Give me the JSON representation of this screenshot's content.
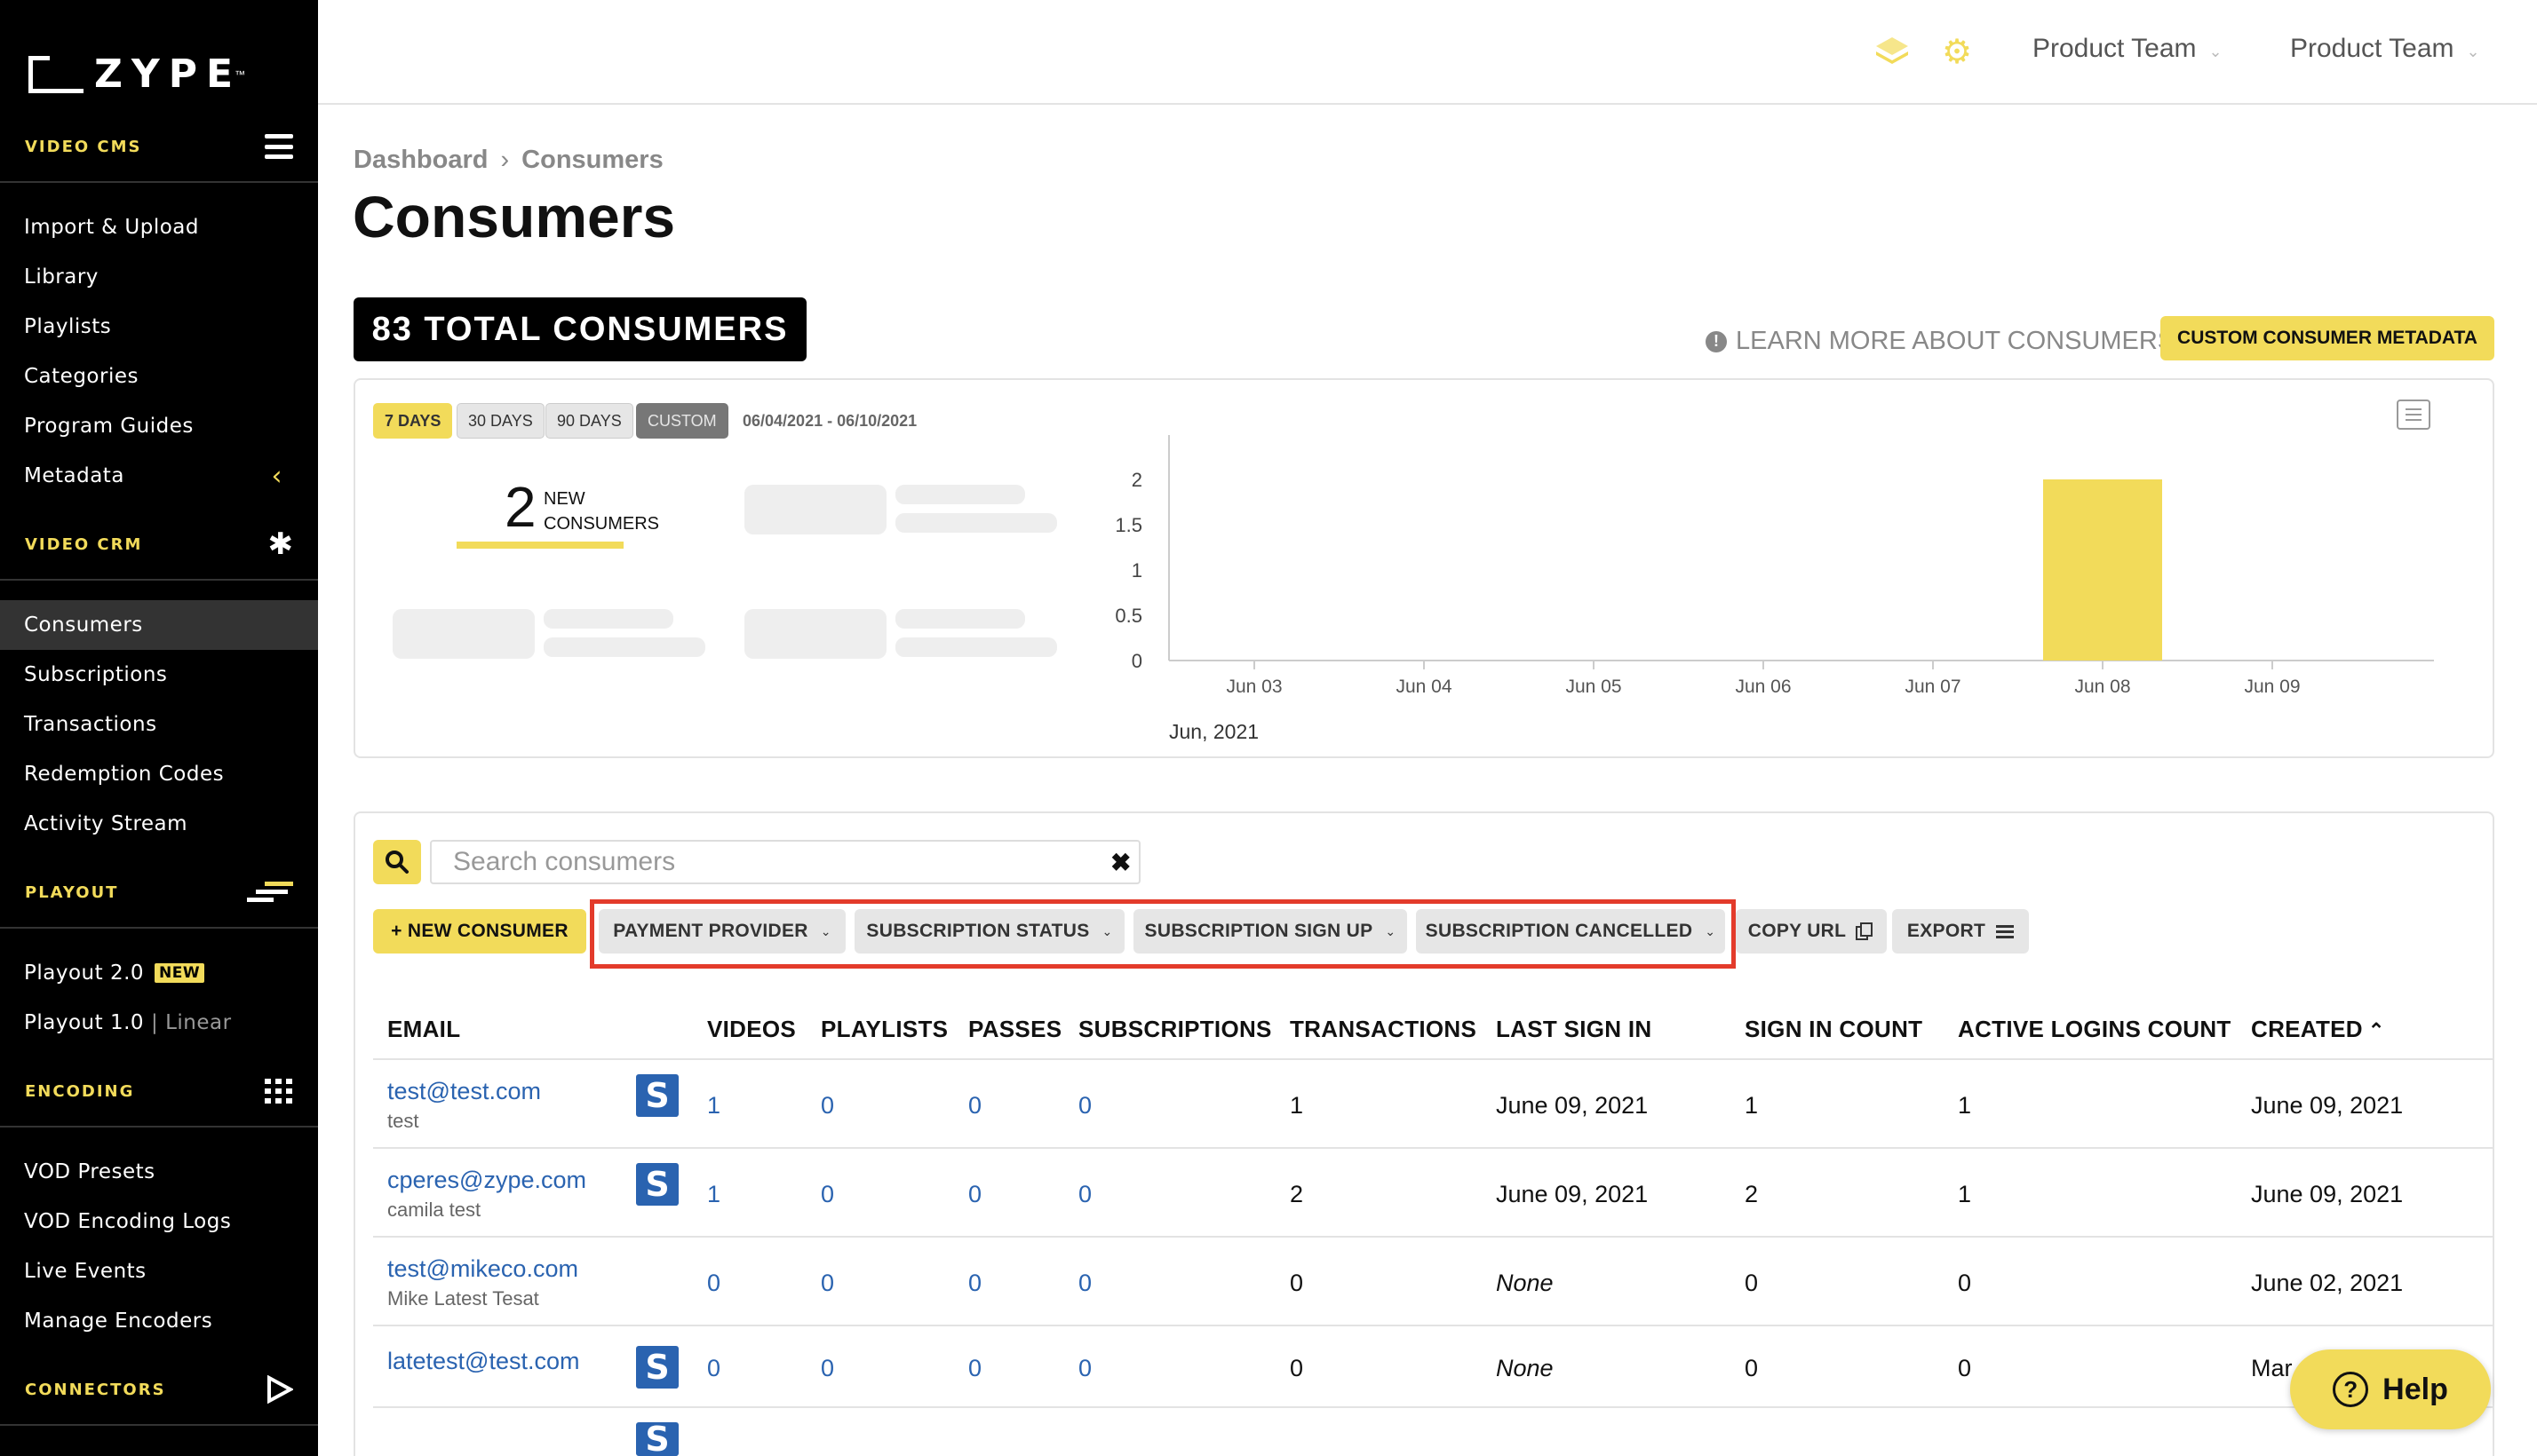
{
  "brand": {
    "name": "ZYPE",
    "tm": "™",
    "accent": "#f2db5a",
    "link": "#2a63b0",
    "highlight": "#e33b2b"
  },
  "sidebar": {
    "sections": [
      {
        "label": "VIDEO CMS",
        "icon": "hamburger-icon",
        "items": [
          "Import & Upload",
          "Library",
          "Playlists",
          "Categories",
          "Program Guides",
          "Metadata"
        ]
      },
      {
        "label": "VIDEO CRM",
        "icon": "asterisk-icon",
        "items": [
          "Consumers",
          "Subscriptions",
          "Transactions",
          "Redemption Codes",
          "Activity Stream"
        ]
      },
      {
        "label": "PLAYOUT",
        "icon": "playout-icon",
        "items": [
          "Playout 2.0",
          "Playout 1.0"
        ]
      },
      {
        "label": "ENCODING",
        "icon": "grid-icon",
        "items": [
          "VOD Presets",
          "VOD Encoding Logs",
          "Live Events",
          "Manage Encoders"
        ]
      },
      {
        "label": "CONNECTORS",
        "icon": "play-icon",
        "items": []
      }
    ],
    "active_item": "Consumers",
    "playout2_badge": "NEW",
    "playout1_suffix": "| Linear"
  },
  "topbar": {
    "team1": "Product Team",
    "team2": "Product Team"
  },
  "breadcrumb": {
    "parent": "Dashboard",
    "current": "Consumers"
  },
  "page_title": "Consumers",
  "total_badge": "83 TOTAL CONSUMERS",
  "learn_more": "LEARN MORE ABOUT CONSUMERS",
  "meta_button": "CUSTOM CONSUMER METADATA",
  "ranges": [
    "7 DAYS",
    "30 DAYS",
    "90 DAYS",
    "CUSTOM"
  ],
  "date_range": "06/04/2021 - 06/10/2021",
  "kpi": {
    "value": "2",
    "label_line1": "NEW",
    "label_line2": "CONSUMERS"
  },
  "chart_data": {
    "type": "bar",
    "categories": [
      "Jun 03",
      "Jun 04",
      "Jun 05",
      "Jun 06",
      "Jun 07",
      "Jun 08",
      "Jun 09"
    ],
    "values": [
      0,
      0,
      0,
      0,
      0,
      2,
      0
    ],
    "y_ticks": [
      "0",
      "0.5",
      "1",
      "1.5",
      "2"
    ],
    "ylim": [
      0,
      2
    ],
    "xlabel": "Jun, 2021",
    "bar_color": "#f2db5a"
  },
  "search": {
    "placeholder": "Search consumers"
  },
  "actions": {
    "new_consumer": "+ NEW CONSUMER",
    "payment_provider": "PAYMENT PROVIDER",
    "subscription_status": "SUBSCRIPTION STATUS",
    "subscription_sign_up": "SUBSCRIPTION SIGN UP",
    "subscription_cancelled": "SUBSCRIPTION CANCELLED",
    "copy_url": "COPY URL",
    "export": "EXPORT"
  },
  "table": {
    "headers": [
      "EMAIL",
      "VIDEOS",
      "PLAYLISTS",
      "PASSES",
      "SUBSCRIPTIONS",
      "TRANSACTIONS",
      "LAST SIGN IN",
      "SIGN IN COUNT",
      "ACTIVE LOGINS COUNT",
      "CREATED"
    ],
    "rows": [
      {
        "email": "test@test.com",
        "name": "test",
        "videos": "1",
        "playlists": "0",
        "passes": "0",
        "subscriptions": "0",
        "transactions": "1",
        "last_sign_in": "June 09, 2021",
        "sign_in_count": "1",
        "active_logins": "1",
        "created": "June 09, 2021"
      },
      {
        "email": "cperes@zype.com",
        "name": "camila test",
        "videos": "1",
        "playlists": "0",
        "passes": "0",
        "subscriptions": "0",
        "transactions": "2",
        "last_sign_in": "June 09, 2021",
        "sign_in_count": "2",
        "active_logins": "1",
        "created": "June 09, 2021"
      },
      {
        "email": "test@mikeco.com",
        "name": "Mike Latest Tesat",
        "videos": "0",
        "playlists": "0",
        "passes": "0",
        "subscriptions": "0",
        "transactions": "0",
        "last_sign_in": "None",
        "sign_in_count": "0",
        "active_logins": "0",
        "created": "June 02, 2021"
      },
      {
        "email": "latetest@test.com",
        "name": "",
        "videos": "0",
        "playlists": "0",
        "passes": "0",
        "subscriptions": "0",
        "transactions": "0",
        "last_sign_in": "None",
        "sign_in_count": "0",
        "active_logins": "0",
        "created": "Mar"
      }
    ]
  },
  "help": "Help"
}
